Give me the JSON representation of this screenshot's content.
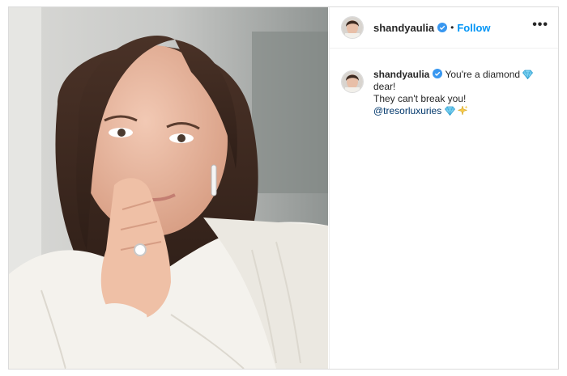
{
  "post": {
    "username": "shandyaulia",
    "follow_label": "Follow",
    "separator": "•",
    "more_label": "•••"
  },
  "comment": {
    "username": "shandyaulia",
    "line1": "You're a diamond",
    "line2": "dear!",
    "line3": "They can't break you!",
    "mention": "@tresorluxuries"
  },
  "colors": {
    "accent": "#0095f6",
    "verified": "#3897f0",
    "mention": "#00376b"
  },
  "icons": [
    "verified-badge-icon",
    "more-options-icon",
    "diamond-emoji-icon",
    "sparkles-emoji-icon"
  ]
}
